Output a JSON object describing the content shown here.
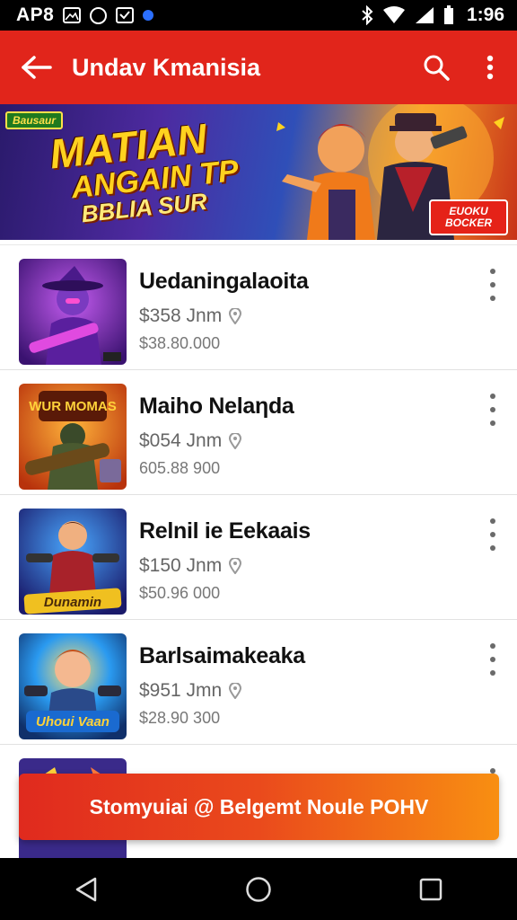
{
  "status_bar": {
    "carrier": "AP8",
    "time": "1:96",
    "icons": [
      "image-icon",
      "camera-icon",
      "inbox-icon",
      "dot-icon",
      "bluetooth-icon",
      "wifi-icon",
      "signal-icon",
      "battery-icon"
    ],
    "dot_color": "#2b6fff"
  },
  "app_bar": {
    "title": "Undav Kmanisia",
    "background": "#e1251b",
    "icons": [
      "back-arrow-icon",
      "search-icon",
      "more-vert-icon"
    ]
  },
  "banner": {
    "badge": "Bausaur",
    "headline_line1": "MATIAN",
    "headline_line2": "ANGAIN TP",
    "headline_line3": "BBLIA SUR",
    "corner_tag": "EUOKU BOCKER"
  },
  "list": {
    "items": [
      {
        "title": "Uedaningalaoita",
        "price": "$358 Jnm",
        "sub": "$38.80.000",
        "thumb_icon": "game-thumbnail-icon"
      },
      {
        "title": "Maiho Nelaηda",
        "price": "$054 Jnm",
        "sub": "605.88 900",
        "thumb_icon": "game-thumbnail-icon",
        "thumb_text": "WUR MOMAS"
      },
      {
        "title": "Relnil ie Eekaais",
        "price": "$150 Jnm",
        "sub": "$50.96 000",
        "thumb_icon": "game-thumbnail-icon",
        "thumb_text": "Dunamin"
      },
      {
        "title": "Barlsaimakeaka",
        "price": "$951 Jmn",
        "sub": "$28.90 300",
        "thumb_icon": "game-thumbnail-icon",
        "thumb_text": "Uhoui Vaan"
      }
    ]
  },
  "promo": {
    "label": "Stomyuiai @ Belgemt Noule POHV",
    "color_start": "#e02a1e",
    "color_end": "#f88f12"
  },
  "nav_bar": {
    "icons": [
      "back-triangle-icon",
      "home-circle-icon",
      "recents-square-icon"
    ]
  }
}
